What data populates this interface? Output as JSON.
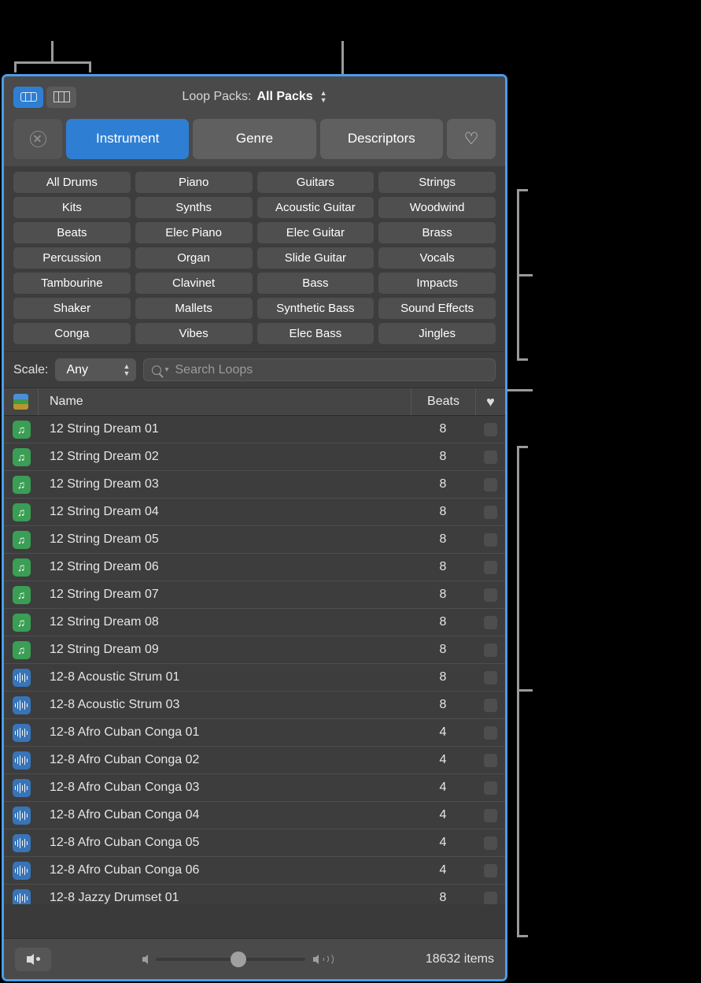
{
  "colors": {
    "accent_blue": "#2e7fd4",
    "panel_border": "#4a9de8",
    "panel_bg": "#3d3d3d",
    "bar_bg": "#4a4a4a",
    "midi_icon": "#3a9e54",
    "audio_icon": "#3874b8",
    "callout": "#9a9a9a"
  },
  "topbar": {
    "view_buttons": [
      {
        "name": "button-view",
        "icon": "rounded-button-view-icon",
        "active": true
      },
      {
        "name": "column-view",
        "icon": "column-view-icon",
        "active": false
      }
    ],
    "loop_packs_label": "Loop Packs:",
    "loop_packs_value": "All Packs",
    "stepper_up": "▲",
    "stepper_down": "▼"
  },
  "filter_tabs": {
    "reset_icon": "circle-x-icon",
    "tabs": [
      {
        "label": "Instrument",
        "active": true
      },
      {
        "label": "Genre",
        "active": false
      },
      {
        "label": "Descriptors",
        "active": false
      }
    ],
    "favorites_icon": "heart-outline-icon"
  },
  "keywords": [
    "All Drums",
    "Piano",
    "Guitars",
    "Strings",
    "Kits",
    "Synths",
    "Acoustic Guitar",
    "Woodwind",
    "Beats",
    "Elec Piano",
    "Elec Guitar",
    "Brass",
    "Percussion",
    "Organ",
    "Slide Guitar",
    "Vocals",
    "Tambourine",
    "Clavinet",
    "Bass",
    "Impacts",
    "Shaker",
    "Mallets",
    "Synthetic Bass",
    "Sound Effects",
    "Conga",
    "Vibes",
    "Elec Bass",
    "Jingles"
  ],
  "scale_row": {
    "label": "Scale:",
    "value": "Any",
    "search_placeholder": "Search Loops",
    "search_value": ""
  },
  "table": {
    "sort_icon": "stacked-colors-icon",
    "columns": [
      "Name",
      "Beats"
    ],
    "favorites_column_icon": "heart-filled-icon",
    "rows": [
      {
        "type": "midi",
        "name": "12 String Dream 01",
        "beats": "8",
        "favorite": false
      },
      {
        "type": "midi",
        "name": "12 String Dream 02",
        "beats": "8",
        "favorite": false
      },
      {
        "type": "midi",
        "name": "12 String Dream 03",
        "beats": "8",
        "favorite": false
      },
      {
        "type": "midi",
        "name": "12 String Dream 04",
        "beats": "8",
        "favorite": false
      },
      {
        "type": "midi",
        "name": "12 String Dream 05",
        "beats": "8",
        "favorite": false
      },
      {
        "type": "midi",
        "name": "12 String Dream 06",
        "beats": "8",
        "favorite": false
      },
      {
        "type": "midi",
        "name": "12 String Dream 07",
        "beats": "8",
        "favorite": false
      },
      {
        "type": "midi",
        "name": "12 String Dream 08",
        "beats": "8",
        "favorite": false
      },
      {
        "type": "midi",
        "name": "12 String Dream 09",
        "beats": "8",
        "favorite": false
      },
      {
        "type": "audio",
        "name": "12-8 Acoustic Strum 01",
        "beats": "8",
        "favorite": false
      },
      {
        "type": "audio",
        "name": "12-8 Acoustic Strum 03",
        "beats": "8",
        "favorite": false
      },
      {
        "type": "audio",
        "name": "12-8 Afro Cuban Conga 01",
        "beats": "4",
        "favorite": false
      },
      {
        "type": "audio",
        "name": "12-8 Afro Cuban Conga 02",
        "beats": "4",
        "favorite": false
      },
      {
        "type": "audio",
        "name": "12-8 Afro Cuban Conga 03",
        "beats": "4",
        "favorite": false
      },
      {
        "type": "audio",
        "name": "12-8 Afro Cuban Conga 04",
        "beats": "4",
        "favorite": false
      },
      {
        "type": "audio",
        "name": "12-8 Afro Cuban Conga 05",
        "beats": "4",
        "favorite": false
      },
      {
        "type": "audio",
        "name": "12-8 Afro Cuban Conga 06",
        "beats": "4",
        "favorite": false
      },
      {
        "type": "audio",
        "name": "12-8 Jazzy Drumset 01",
        "beats": "8",
        "favorite": false
      }
    ]
  },
  "bottombar": {
    "preview_icon": "speaker-preview-icon",
    "volume_low_icon": "speaker-low-icon",
    "volume_high_icon": "speaker-high-icon",
    "volume_percent": 50,
    "item_count": "18632 items"
  }
}
